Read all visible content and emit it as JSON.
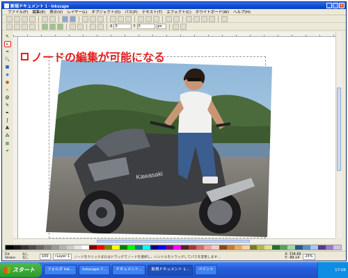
{
  "window": {
    "title": "新規ドキュメント 1 - Inkscape",
    "minimize": "_",
    "maximize": "□",
    "close": "x"
  },
  "menu": [
    "ファイル(F)",
    "編集(E)",
    "表示(V)",
    "レイヤー(L)",
    "オブジェクト(O)",
    "パス(P)",
    "テキスト(T)",
    "エフェクト(C)",
    "ホワイトボード(W)",
    "ヘルプ(H)"
  ],
  "toolbar2": {
    "width_value": "0",
    "height_value": "0",
    "unit": "px"
  },
  "caption": {
    "text": "ノードの編集が可能になる"
  },
  "status": {
    "fill_label": "Fill:",
    "stroke_label": "Stroke:",
    "fill_value": "なし",
    "stroke_value": "なし",
    "opacity": "100",
    "layer": "•Layer 1",
    "message": "ノードをクリックまたはドラッグでノードを選択し、ハンドルをドラッグしてパスを変更します...",
    "coords_x": "X: 334.69",
    "coords_y": "Y: -99.14",
    "zoom": "25%"
  },
  "taskbar": {
    "start": "スタート",
    "tasks": [
      "フォルダ Ink...",
      "Inkscape 7...",
      "ドキュメント...",
      "新規ドキュメント 1...",
      "ペイント"
    ],
    "clock": "17:06"
  },
  "colors": {
    "accent_red": "#e81c1c",
    "titlebar_blue": "#0b4bd6",
    "taskbar_blue": "#245edb"
  }
}
